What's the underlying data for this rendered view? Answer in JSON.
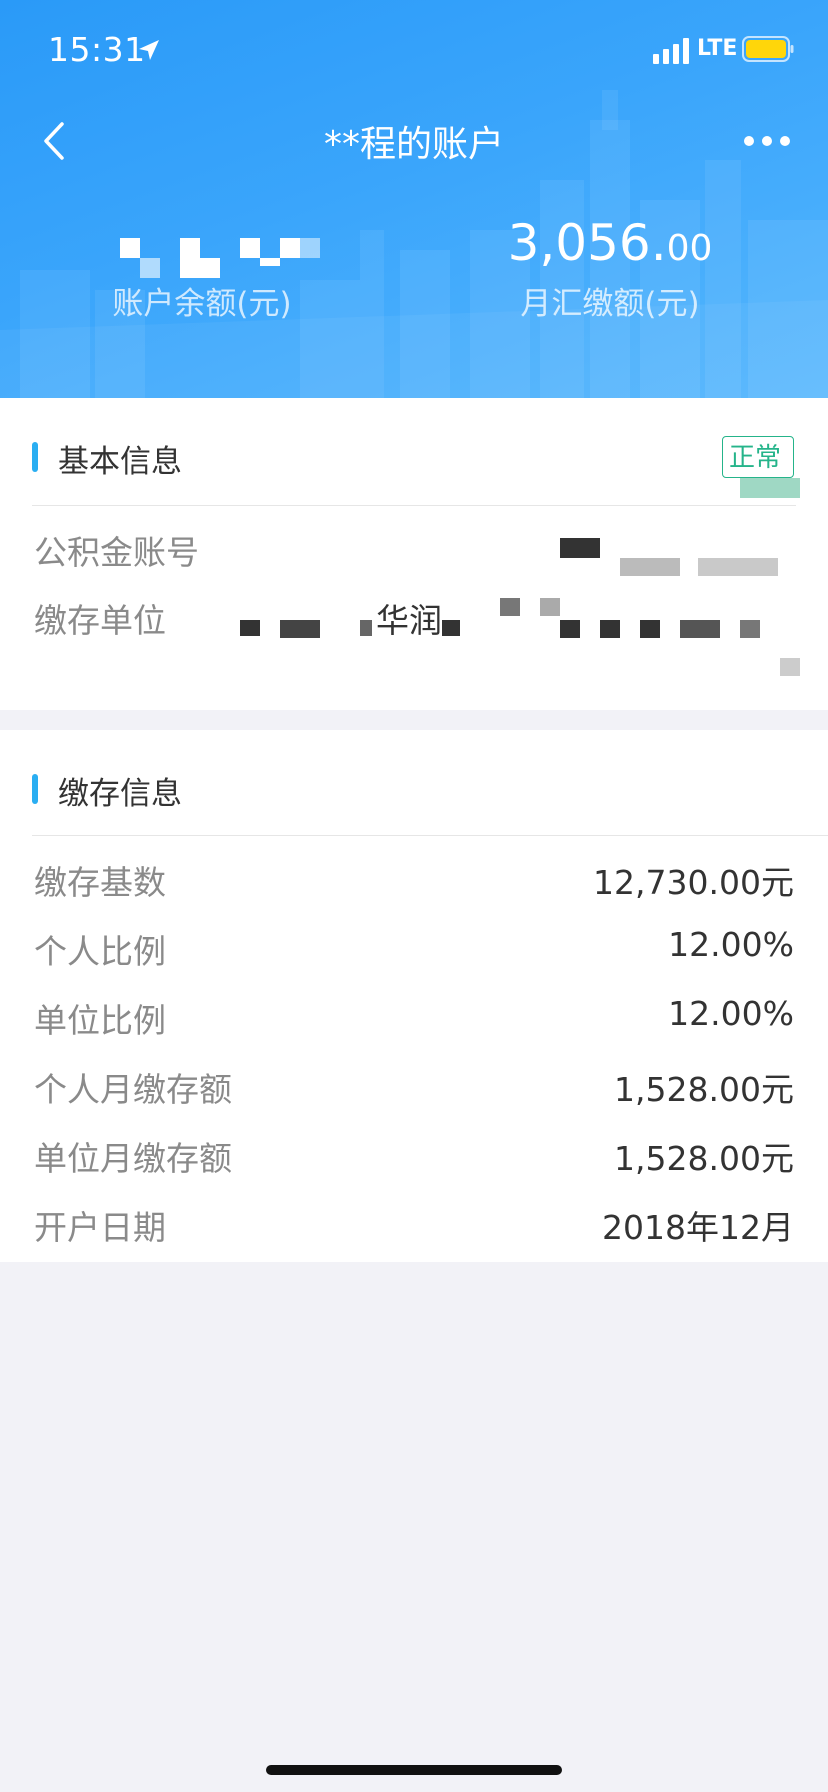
{
  "status_bar": {
    "time": "15:31",
    "network": "LTE"
  },
  "header": {
    "title": "**程的账户"
  },
  "summary": {
    "balance_label": "账户余额(元)",
    "monthly_value_main": "3,056.",
    "monthly_value_decimal": "00",
    "monthly_label": "月汇缴额(元)"
  },
  "basic_info": {
    "title": "基本信息",
    "status_badge": "正常",
    "account_label": "公积金账号",
    "employer_label": "缴存单位",
    "employer_visible_text": "华润"
  },
  "deposit_info": {
    "title": "缴存信息",
    "rows": [
      {
        "label": "缴存基数",
        "value": "12,730.00元"
      },
      {
        "label": "个人比例",
        "value": "12.00%"
      },
      {
        "label": "单位比例",
        "value": "12.00%"
      },
      {
        "label": "个人月缴存额",
        "value": "1,528.00元"
      },
      {
        "label": "单位月缴存额",
        "value": "1,528.00元"
      },
      {
        "label": "开户日期",
        "value": "2018年12月"
      }
    ]
  },
  "colors": {
    "header_blue": "#2a9af8",
    "accent": "#2aaef2",
    "badge_green": "#25b48a"
  },
  "icons": [
    "location-arrow-icon",
    "signal-icon",
    "battery-icon",
    "back-arrow-icon",
    "more-icon"
  ]
}
